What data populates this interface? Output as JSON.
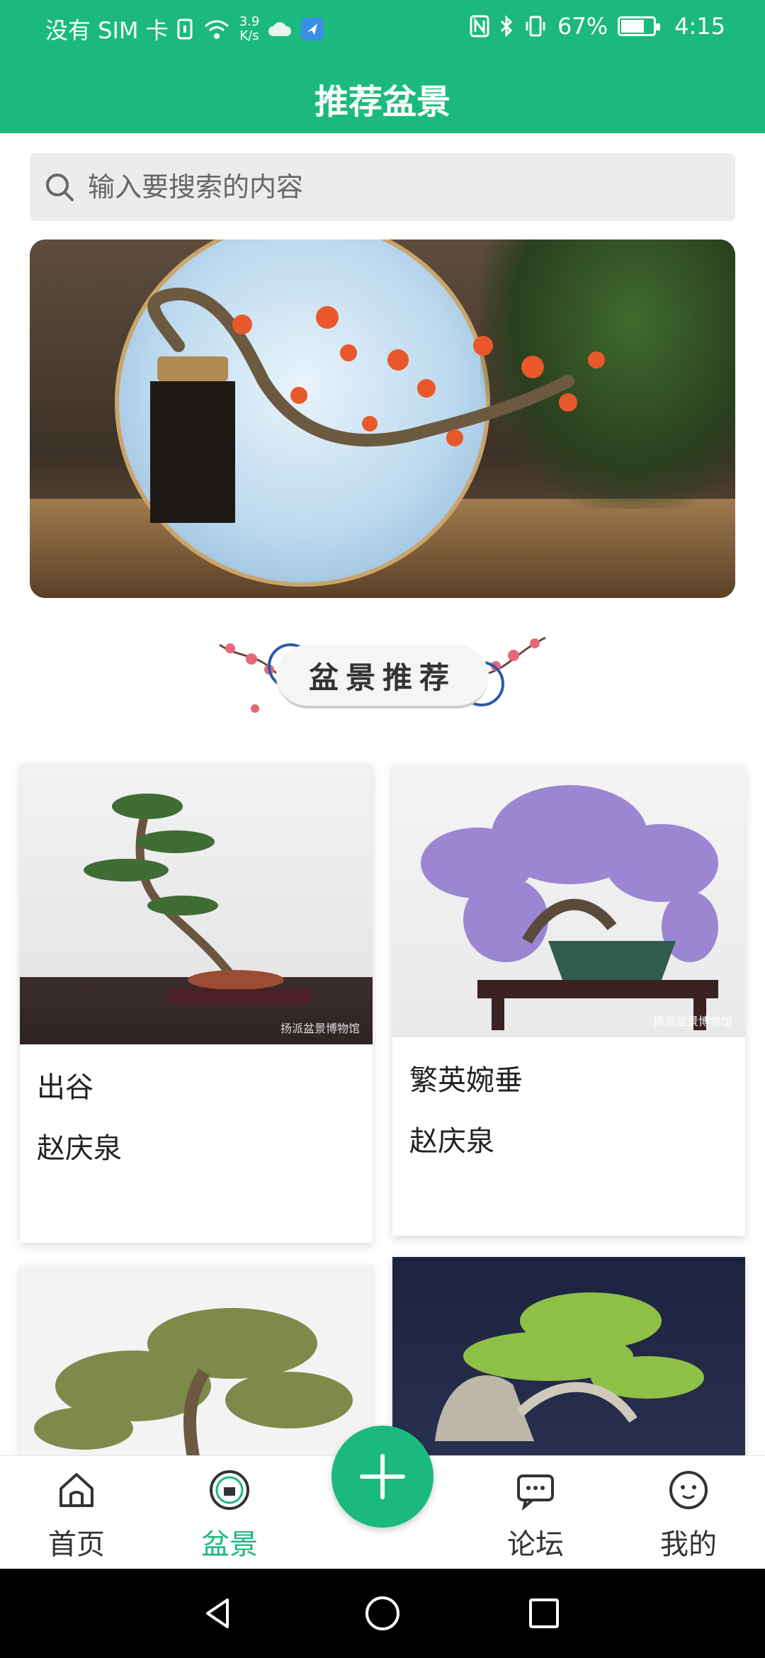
{
  "status_bar": {
    "carrier": "没有 SIM 卡",
    "speed_value": "3.9",
    "speed_unit": "K/s",
    "battery": "67%",
    "battery_level": 0.67,
    "time": "4:15"
  },
  "header": {
    "title": "推荐盆景"
  },
  "search": {
    "placeholder": "输入要搜索的内容"
  },
  "section": {
    "title": "盆景推荐"
  },
  "cards": [
    {
      "title": "出谷",
      "author": "赵庆泉",
      "watermark": "扬派盆景博物馆"
    },
    {
      "title": "繁英婉垂",
      "author": "赵庆泉",
      "watermark": "扬派盆景博物馆"
    },
    {
      "title": "",
      "author": ""
    },
    {
      "title": "",
      "author": ""
    }
  ],
  "bottom_nav": {
    "items": [
      {
        "label": "首页",
        "icon": "home-icon"
      },
      {
        "label": "盆景",
        "icon": "bonsai-icon",
        "active": true
      },
      {
        "label": "论坛",
        "icon": "forum-icon"
      },
      {
        "label": "我的",
        "icon": "profile-icon"
      }
    ],
    "fab_icon": "plus-icon"
  },
  "colors": {
    "accent": "#1cb97e"
  }
}
